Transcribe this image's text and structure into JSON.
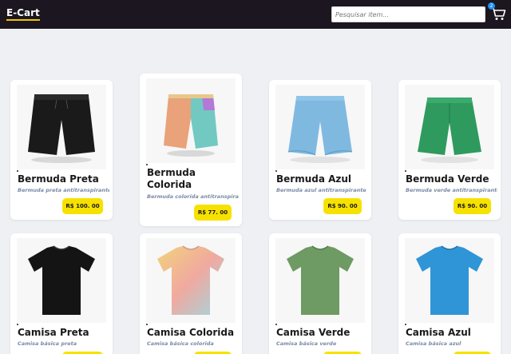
{
  "header": {
    "logo": "E-Cart",
    "search_placeholder": "Pesquisar item...",
    "cart_count": "2"
  },
  "products": [
    {
      "name": "Bermuda Preta",
      "description": "Bermuda preta antitranspirante",
      "price": "R$ 100. 00",
      "color": "#1a1a1a",
      "icon": "black-shorts-image"
    },
    {
      "name": "Bermuda Colorida",
      "description": "Bermuda colorida antitranspirante",
      "price": "R$ 77. 00",
      "color": "#e9a27a",
      "icon": "colorful-shorts-image"
    },
    {
      "name": "Bermuda Azul",
      "description": "Bermuda azul antitranspirante",
      "price": "R$ 90. 00",
      "color": "#7fb9e0",
      "icon": "blue-shorts-image"
    },
    {
      "name": "Bermuda Verde",
      "description": "Bermuda verde antitranspirante",
      "price": "R$ 90. 00",
      "color": "#2f9a5e",
      "icon": "green-shorts-image"
    },
    {
      "name": "Camisa Preta",
      "description": "Camisa básica preta",
      "price": "",
      "color": "#141414",
      "icon": "black-tshirt-image"
    },
    {
      "name": "Camisa Colorida",
      "description": "Camisa básica colorida",
      "price": "",
      "color": "#e6c07a",
      "icon": "colorful-tshirt-image"
    },
    {
      "name": "Camisa Verde",
      "description": "Camisa básica verde",
      "price": "",
      "color": "#6e9a63",
      "icon": "green-tshirt-image"
    },
    {
      "name": "Camisa Azul",
      "description": "Camisa básica azul",
      "price": "",
      "color": "#2f95d6",
      "icon": "blue-tshirt-image"
    }
  ]
}
